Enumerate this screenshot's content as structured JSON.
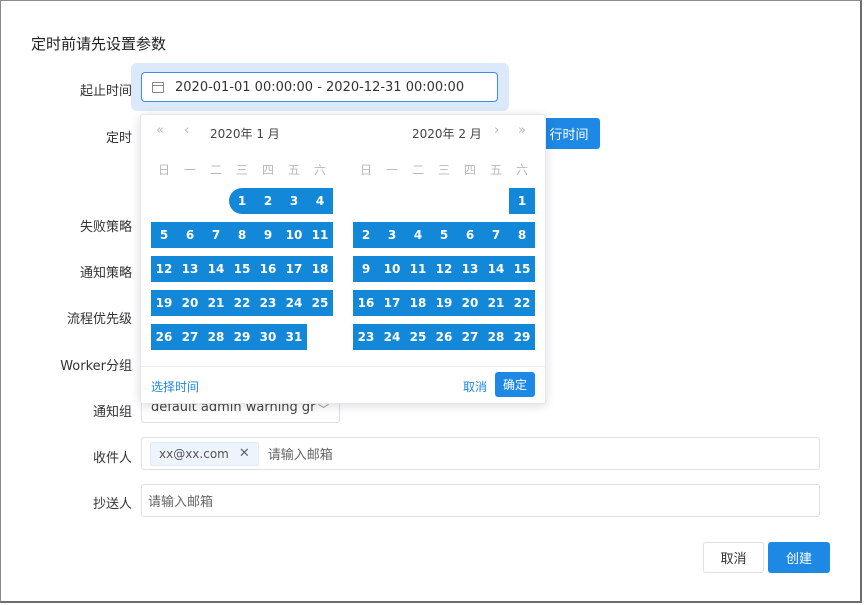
{
  "dialog": {
    "title": "定时前请先设置参数",
    "labels": {
      "range": "起止时间",
      "schedule": "定时",
      "failure": "失败策略",
      "notify_strategy": "通知策略",
      "priority": "流程优先级",
      "worker": "Worker分组",
      "notify_group": "通知组",
      "receivers": "收件人",
      "cc": "抄送人"
    },
    "range_value": "2020-01-01 00:00:00 - 2020-12-31 00:00:00",
    "run_time_button": "行时间",
    "notify_group_value": "default admin warning gr",
    "receiver_tag": "xx@xx.com",
    "receiver_placeholder": "请输入邮箱",
    "cc_placeholder": "请输入邮箱",
    "cancel_label": "取消",
    "create_label": "创建"
  },
  "picker": {
    "left_month": "2020年 1 月",
    "right_month": "2020年 2 月",
    "weekdays": [
      "日",
      "一",
      "二",
      "三",
      "四",
      "五",
      "六"
    ],
    "left_first_weekday": 3,
    "left_days": 31,
    "right_first_weekday": 6,
    "right_days": 29,
    "nav_prev_year": "«",
    "nav_prev_month": "‹",
    "nav_next_month": "›",
    "nav_next_year": "»",
    "select_time": "选择时间",
    "cancel": "取消",
    "ok": "确定"
  },
  "colors": {
    "accent": "#1e88e5",
    "range_cell": "#1388d8"
  }
}
